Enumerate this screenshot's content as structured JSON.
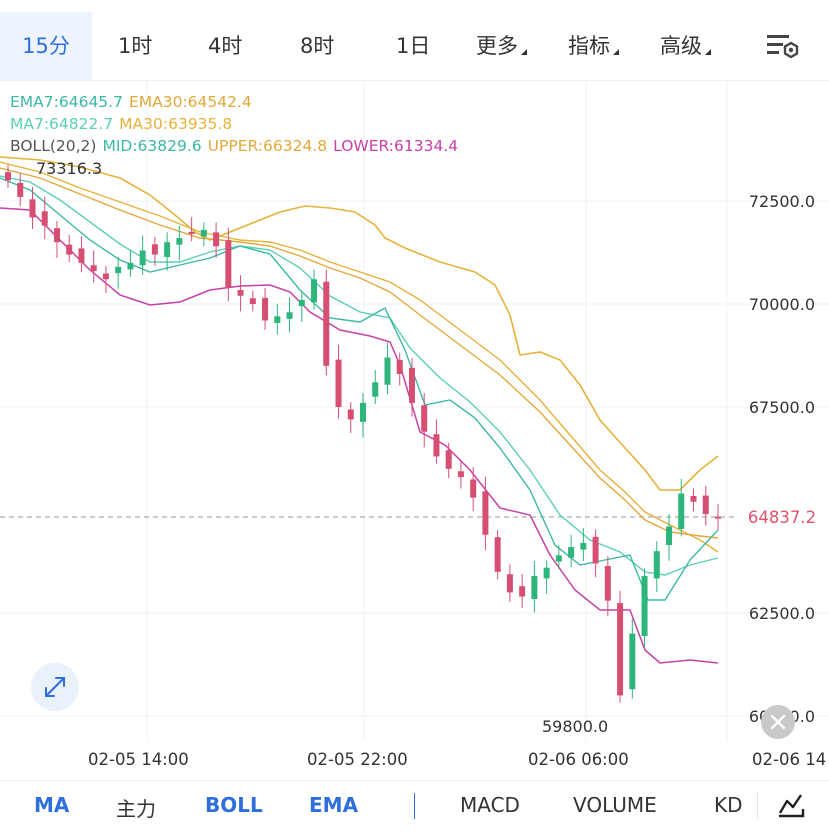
{
  "timeframes": [
    {
      "label": "15分",
      "active": true
    },
    {
      "label": "1时",
      "active": false
    },
    {
      "label": "4时",
      "active": false
    },
    {
      "label": "8时",
      "active": false
    },
    {
      "label": "1日",
      "active": false
    },
    {
      "label": "更多",
      "active": false,
      "dropdown": true
    },
    {
      "label": "指标",
      "active": false,
      "dropdown": true
    },
    {
      "label": "高级",
      "active": false,
      "dropdown": true
    }
  ],
  "legend": {
    "ema7": "EMA7:64645.7",
    "ema30": "EMA30:64542.4",
    "ma7": "MA7:64822.7",
    "ma30": "MA30:63935.8",
    "boll": "BOLL(20,2)",
    "mid": "MID:63829.6",
    "upper": "UPPER:66324.8",
    "lower": "LOWER:61334.4"
  },
  "colors": {
    "up": "#2eb57c",
    "down": "#d64f73",
    "ema7": "#3db8a6",
    "ema30": "#e2a83a",
    "ma7": "#5ccfb6",
    "ma30": "#e6b23a",
    "boll_mid": "#5ccfb6",
    "boll_upper": "#e6b23a",
    "boll_lower": "#c840a8",
    "accent": "#2f6fdb"
  },
  "price_axis": [
    "72500.0",
    "70000.0",
    "67500.0",
    "65000.0",
    "62500.0",
    "60000.0"
  ],
  "time_axis": [
    "02-05 14:00",
    "02-05 22:00",
    "02-06 06:00",
    "02-06 14"
  ],
  "current_price": "64837.2",
  "high_marker": "73316.3",
  "low_marker": "59800.0",
  "indicator_tabs": [
    {
      "label": "MA",
      "active": true
    },
    {
      "label": "主力",
      "active": false
    },
    {
      "label": "BOLL",
      "active": true
    },
    {
      "label": "EMA",
      "active": true
    },
    {
      "label": "MACD",
      "active": false
    },
    {
      "label": "VOLUME",
      "active": false
    },
    {
      "label": "KD",
      "active": false
    }
  ],
  "icons": [
    "settings-icon",
    "expand-icon",
    "close-icon",
    "chart-draw-icon"
  ],
  "chart_data": {
    "type": "candlestick",
    "ylim": [
      59800,
      73316.3
    ],
    "candles_close_approx": [
      73000,
      72600,
      72100,
      71900,
      71500,
      71200,
      71000,
      70800,
      70600,
      70900,
      71000,
      71300,
      71200,
      71500,
      71600,
      71700,
      71800,
      71400,
      70400,
      70200,
      70000,
      69600,
      69700,
      69800,
      70100,
      70600,
      68500,
      67500,
      67200,
      67600,
      68100,
      68700,
      68300,
      67600,
      66900,
      66300,
      66000,
      65800,
      65300,
      64400,
      63500,
      63000,
      62900,
      63400,
      63600,
      63900,
      64100,
      64200,
      63700,
      62800,
      60500,
      62000,
      63400,
      64000,
      64600,
      65400,
      65200,
      64900,
      64837.2
    ]
  }
}
